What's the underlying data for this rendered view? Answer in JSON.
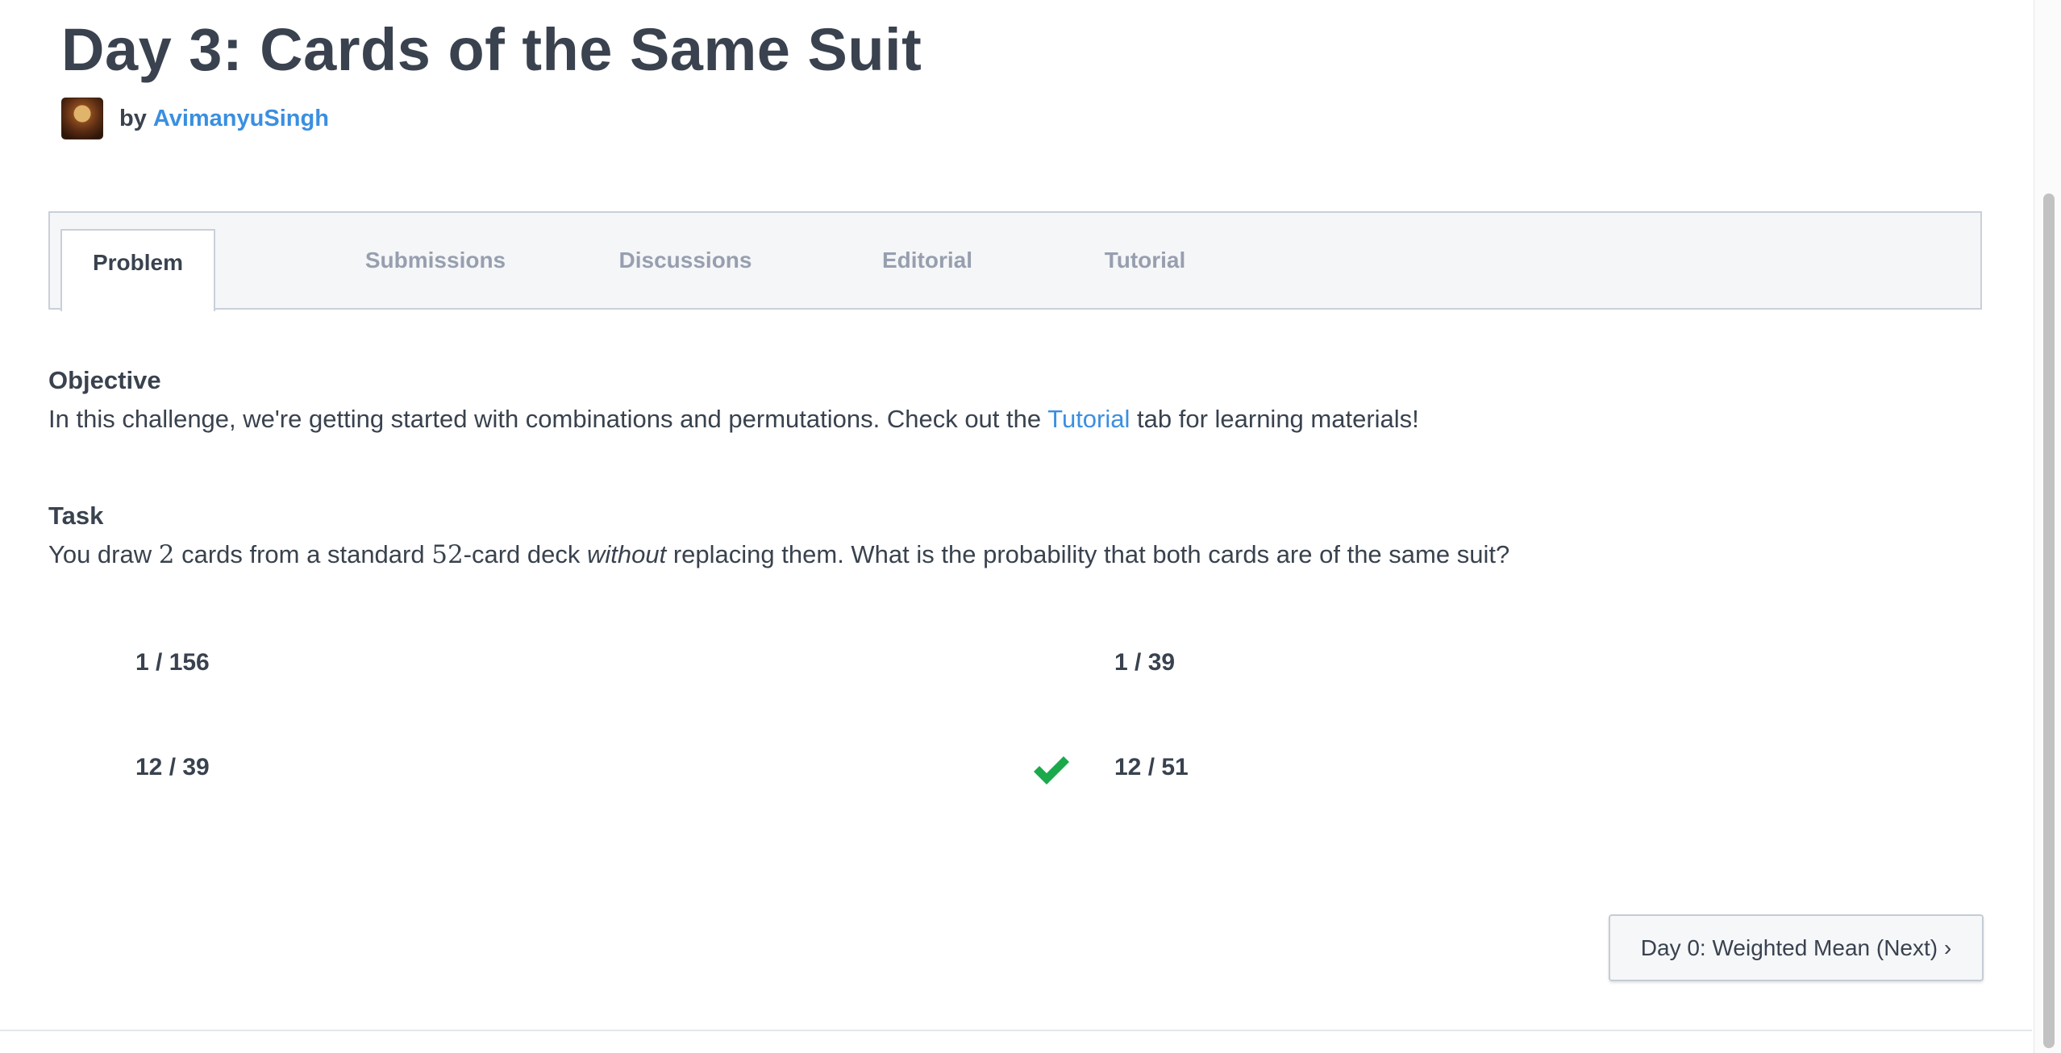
{
  "header": {
    "title": "Day 3: Cards of the Same Suit",
    "by_label": "by",
    "author": "AvimanyuSingh"
  },
  "tabs": [
    {
      "label": "Problem",
      "active": true
    },
    {
      "label": "Submissions",
      "active": false
    },
    {
      "label": "Discussions",
      "active": false
    },
    {
      "label": "Editorial",
      "active": false
    },
    {
      "label": "Tutorial",
      "active": false
    }
  ],
  "objective": {
    "heading": "Objective",
    "text_before": "In this challenge, we're getting started with combinations and permutations. Check out the ",
    "link": "Tutorial",
    "text_after": " tab for learning materials!"
  },
  "task": {
    "heading": "Task",
    "p1": "You draw ",
    "n1": "2",
    "p2": " cards from a standard ",
    "n2": "52",
    "p3": "-card deck ",
    "emph": "without",
    "p4": " replacing them. What is the probability that both cards are of the same suit?"
  },
  "options": [
    {
      "label": "1 / 156",
      "correct": false
    },
    {
      "label": "1 / 39",
      "correct": false
    },
    {
      "label": "12 / 39",
      "correct": false
    },
    {
      "label": "12 / 51",
      "correct": true
    }
  ],
  "icons": {
    "correct_marker": "check-icon"
  },
  "colors": {
    "link": "#3a8fe0",
    "correct": "#1ba94c",
    "text": "#39424e"
  },
  "next_button": {
    "label": "Day 0: Weighted Mean (Next) ›"
  }
}
